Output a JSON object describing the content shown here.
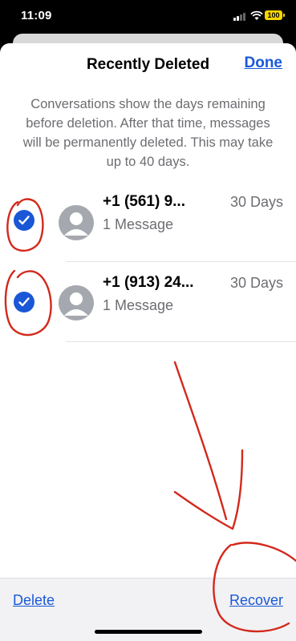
{
  "status_bar": {
    "time": "11:09",
    "battery": "100"
  },
  "header": {
    "title": "Recently Deleted",
    "done_label": "Done"
  },
  "description": "Conversations show the days remaining before deletion. After that time, messages will be permanently deleted. This may take up to 40 days.",
  "conversations": [
    {
      "name": "+1 (561) 9...",
      "days": "30 Days",
      "subtitle": "1 Message",
      "selected": true
    },
    {
      "name": "+1 (913) 24...",
      "days": "30 Days",
      "subtitle": "1 Message",
      "selected": true
    }
  ],
  "toolbar": {
    "delete_label": "Delete",
    "recover_label": "Recover"
  },
  "colors": {
    "accent": "#1a58d8",
    "annotation": "#d3291c"
  }
}
